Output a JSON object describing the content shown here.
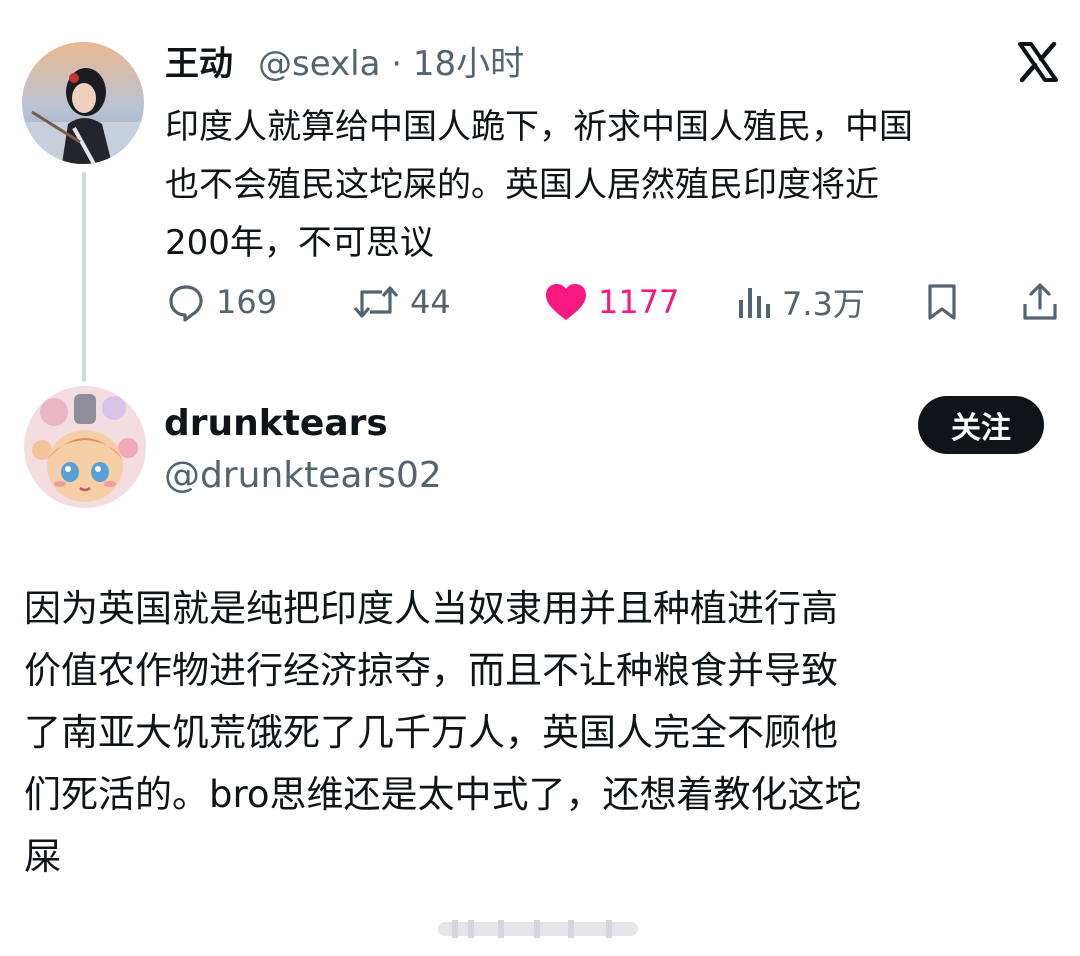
{
  "tweet": {
    "author_name": "王动",
    "author_meta": "@sexla · 18小时",
    "text_lines": [
      "印度人就算给中国人跪下，祈求中国人殖民，中国",
      "也不会殖民这坨屎的。英国人居然殖民印度将近",
      "200年，不可思议"
    ],
    "actions": {
      "replies": "169",
      "retweets": "44",
      "likes": "1177",
      "views": "7.3万"
    }
  },
  "reply": {
    "author_name": "drunktears",
    "author_handle": "@drunktears02",
    "follow_label": "关注",
    "text_lines": [
      "因为英国就是纯把印度人当奴隶用并且种植进行高",
      "价值农作物进行经济掠夺，而且不让种粮食并导致",
      "了南亚大饥荒饿死了几千万人，英国人完全不顾他",
      "们死活的。bro思维还是太中式了，还想着教化这坨",
      "屎"
    ]
  },
  "colors": {
    "text": "#0f1419",
    "secondary": "#536471",
    "like": "#f91880",
    "thread_line": "#cfd9de"
  }
}
